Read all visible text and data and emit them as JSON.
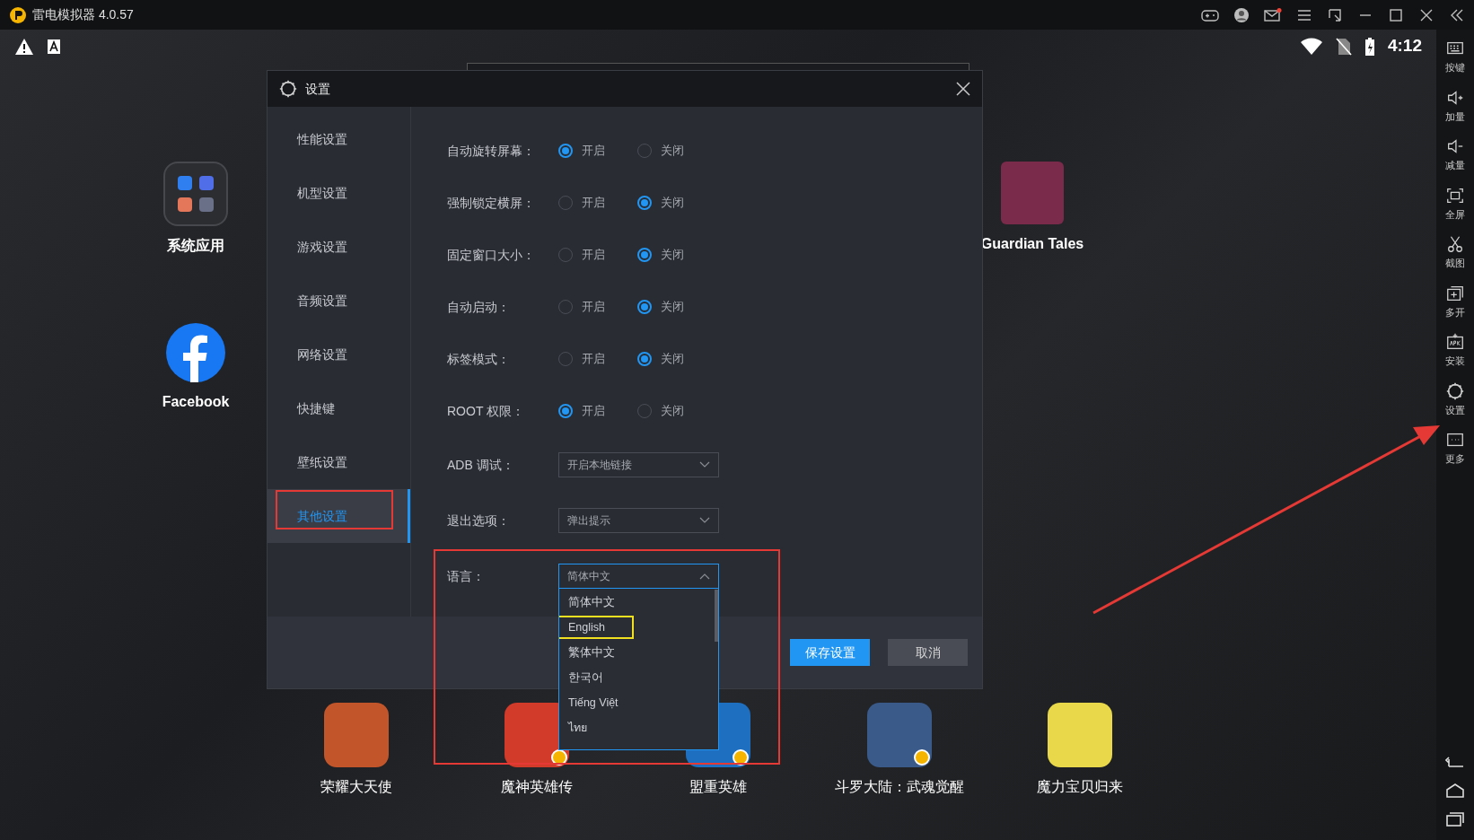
{
  "window": {
    "title": "雷电模拟器 4.0.57"
  },
  "status_bar": {
    "time": "4:12"
  },
  "right_toolbar": [
    {
      "kind": "keyboard",
      "label": "按键"
    },
    {
      "kind": "volume-up",
      "label": "加量"
    },
    {
      "kind": "volume-down",
      "label": "减量"
    },
    {
      "kind": "fullscreen",
      "label": "全屏"
    },
    {
      "kind": "scissors",
      "label": "截图"
    },
    {
      "kind": "multi",
      "label": "多开"
    },
    {
      "kind": "apk",
      "label": "安装"
    },
    {
      "kind": "gear",
      "label": "设置"
    },
    {
      "kind": "more",
      "label": "更多"
    }
  ],
  "desktop": {
    "icons": [
      {
        "kind": "folder",
        "label": "系统应用"
      },
      {
        "kind": "facebook",
        "label": "Facebook"
      },
      {
        "kind": "game",
        "label": "Guardian Tales",
        "color": "#7a2a4a"
      }
    ],
    "dock": [
      {
        "label": "荣耀大天使",
        "color": "#c2552a",
        "badge": false
      },
      {
        "label": "魔神英雄传",
        "color": "#d23a2a",
        "badge": true
      },
      {
        "label": "盟重英雄",
        "color": "#1f6fc0",
        "badge": true
      },
      {
        "label": "斗罗大陆：武魂觉醒",
        "color": "#3a5a8a",
        "badge": true
      },
      {
        "label": "魔力宝贝归来",
        "color": "#e8d84a",
        "badge": false
      }
    ]
  },
  "dialog": {
    "title": "设置",
    "nav": [
      {
        "label": "性能设置",
        "selected": false
      },
      {
        "label": "机型设置",
        "selected": false
      },
      {
        "label": "游戏设置",
        "selected": false
      },
      {
        "label": "音频设置",
        "selected": false
      },
      {
        "label": "网络设置",
        "selected": false
      },
      {
        "label": "快捷键",
        "selected": false
      },
      {
        "label": "壁纸设置",
        "selected": false
      },
      {
        "label": "其他设置",
        "selected": true
      }
    ],
    "options": [
      {
        "kind": "radio",
        "label": "自动旋转屏幕：",
        "choices": [
          {
            "label": "开启",
            "selected": true
          },
          {
            "label": "关闭",
            "selected": false
          }
        ]
      },
      {
        "kind": "radio",
        "label": "强制锁定横屏：",
        "choices": [
          {
            "label": "开启",
            "selected": false
          },
          {
            "label": "关闭",
            "selected": true
          }
        ]
      },
      {
        "kind": "radio",
        "label": "固定窗口大小：",
        "choices": [
          {
            "label": "开启",
            "selected": false
          },
          {
            "label": "关闭",
            "selected": true
          }
        ]
      },
      {
        "kind": "radio",
        "label": "自动启动：",
        "choices": [
          {
            "label": "开启",
            "selected": false
          },
          {
            "label": "关闭",
            "selected": true
          }
        ]
      },
      {
        "kind": "radio",
        "label": "标签模式：",
        "choices": [
          {
            "label": "开启",
            "selected": false
          },
          {
            "label": "关闭",
            "selected": true
          }
        ]
      },
      {
        "kind": "radio",
        "label": "ROOT 权限：",
        "choices": [
          {
            "label": "开启",
            "selected": true
          },
          {
            "label": "关闭",
            "selected": false
          }
        ]
      },
      {
        "kind": "select",
        "label": "ADB 调试：",
        "value": "开启本地链接",
        "expanded": false
      },
      {
        "kind": "select",
        "label": "退出选项：",
        "value": "弹出提示",
        "expanded": false
      },
      {
        "kind": "select",
        "label": "语言：",
        "value": "简体中文",
        "expanded": true,
        "options": [
          {
            "label": "简体中文",
            "highlighted": false
          },
          {
            "label": "English",
            "highlighted": true
          },
          {
            "label": "繁体中文",
            "highlighted": false
          },
          {
            "label": "한국어",
            "highlighted": false
          },
          {
            "label": "Tiếng Việt",
            "highlighted": false
          },
          {
            "label": "ไทย",
            "highlighted": false
          }
        ]
      }
    ],
    "buttons": [
      {
        "kind": "primary",
        "label": "保存设置"
      },
      {
        "kind": "secondary",
        "label": "取消"
      }
    ]
  }
}
